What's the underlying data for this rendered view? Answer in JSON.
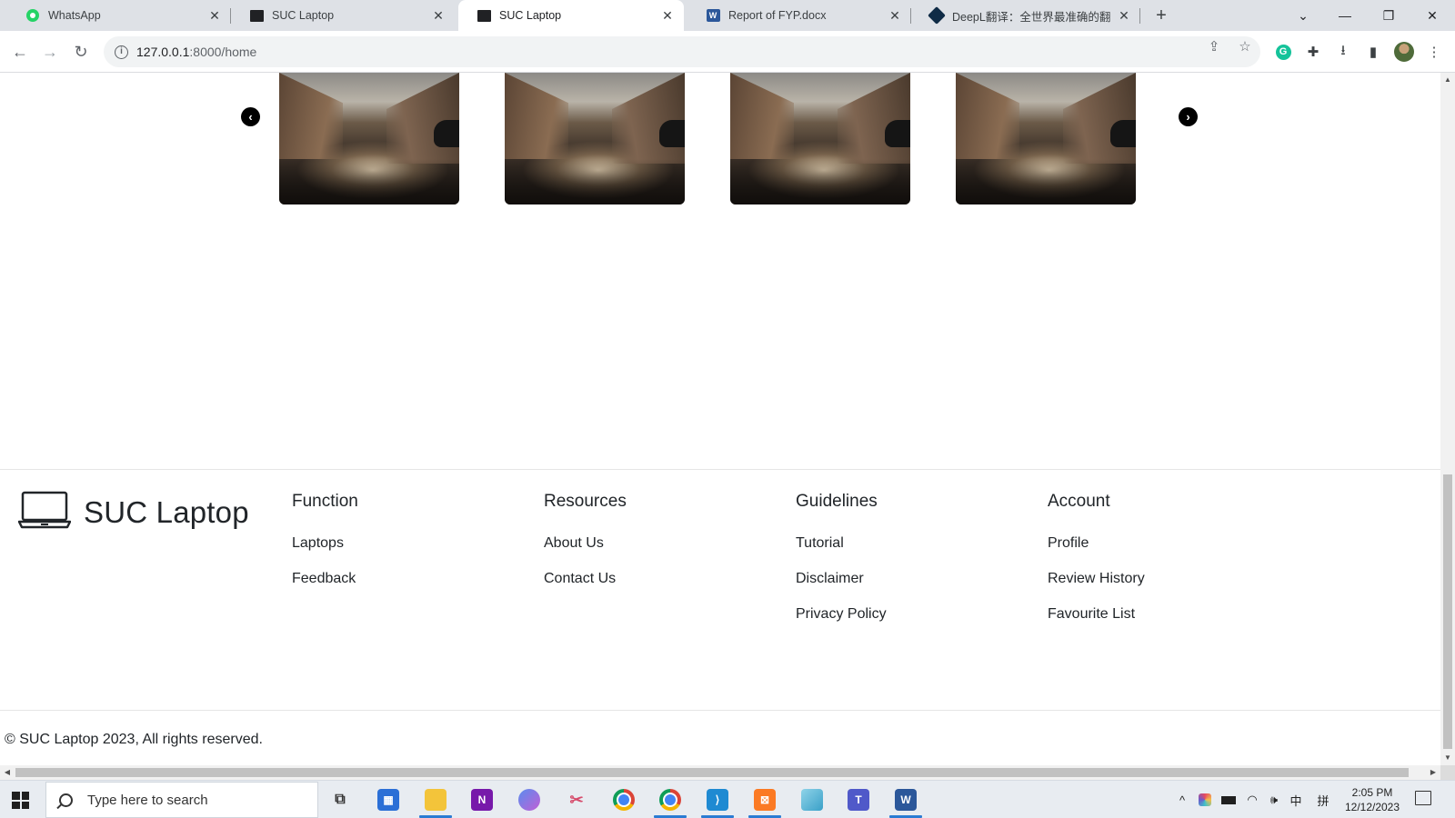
{
  "browser": {
    "tabs": [
      {
        "label": "WhatsApp",
        "icon": "whatsapp-icon",
        "active": false
      },
      {
        "label": "SUC Laptop",
        "icon": "monitor-icon",
        "active": false
      },
      {
        "label": "SUC Laptop",
        "icon": "monitor-icon",
        "active": true
      },
      {
        "label": "Report of FYP.docx",
        "icon": "word-icon",
        "active": false
      },
      {
        "label": "DeepL翻译：全世界最准确的翻译",
        "icon": "deepl-icon",
        "active": false
      }
    ],
    "new_tab_symbol": "+",
    "url_host": "127.0.0.1",
    "url_rest": ":8000/home"
  },
  "carousel": {
    "prev_symbol": "‹",
    "next_symbol": "›",
    "image_count": 4
  },
  "footer": {
    "brand": "SUC Laptop",
    "columns": [
      {
        "heading": "Function",
        "links": [
          "Laptops",
          "Feedback"
        ]
      },
      {
        "heading": "Resources",
        "links": [
          "About Us",
          "Contact Us"
        ]
      },
      {
        "heading": "Guidelines",
        "links": [
          "Tutorial",
          "Disclaimer",
          "Privacy Policy"
        ]
      },
      {
        "heading": "Account",
        "links": [
          "Profile",
          "Review History",
          "Favourite List"
        ]
      }
    ],
    "copyright": "© SUC Laptop 2023, All rights reserved."
  },
  "taskbar": {
    "search_placeholder": "Type here to search",
    "apps": [
      "task-view",
      "microsoft-store",
      "file-explorer",
      "onenote",
      "copilot",
      "snipping-tool",
      "chrome",
      "chrome",
      "vscode",
      "xampp",
      "notepad",
      "teams",
      "word"
    ],
    "ime_label": "中",
    "ime_mode": "拼",
    "time": "2:05 PM",
    "date": "12/12/2023"
  }
}
